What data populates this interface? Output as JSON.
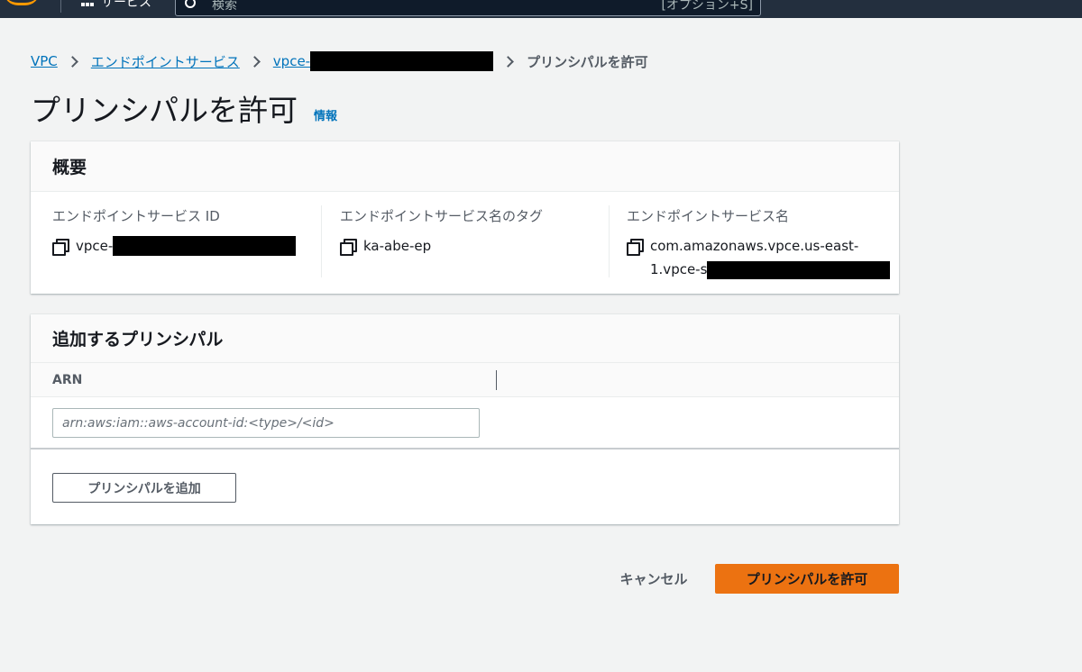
{
  "topbar": {
    "services_label": "サービス",
    "search_placeholder": "検索",
    "search_shortcut": "[オプション+S]"
  },
  "breadcrumb": {
    "items": [
      "VPC",
      "エンドポイントサービス",
      "vpce-"
    ],
    "current": "プリンシパルを許可"
  },
  "page": {
    "title": "プリンシパルを許可",
    "info_link": "情報"
  },
  "summary": {
    "heading": "概要",
    "columns": [
      {
        "label": "エンドポイントサービス ID",
        "value": "vpce-"
      },
      {
        "label": "エンドポイントサービス名のタグ",
        "value": "ka-abe-ep"
      },
      {
        "label": "エンドポイントサービス名",
        "value_line1": "com.amazonaws.vpce.us-east-",
        "value_line2": "1.vpce-s"
      }
    ]
  },
  "principals": {
    "heading": "追加するプリンシパル",
    "column_header": "ARN",
    "input_placeholder": "arn:aws:iam::aws-account-id:<type>/<id>",
    "input_value": "",
    "add_button": "プリンシパルを追加"
  },
  "footer": {
    "cancel_label": "キャンセル",
    "submit_label": "プリンシパルを許可"
  },
  "colors": {
    "link": "#0073bb",
    "primary": "#ec7211",
    "header": "#232f3e",
    "background": "#f2f3f3"
  }
}
